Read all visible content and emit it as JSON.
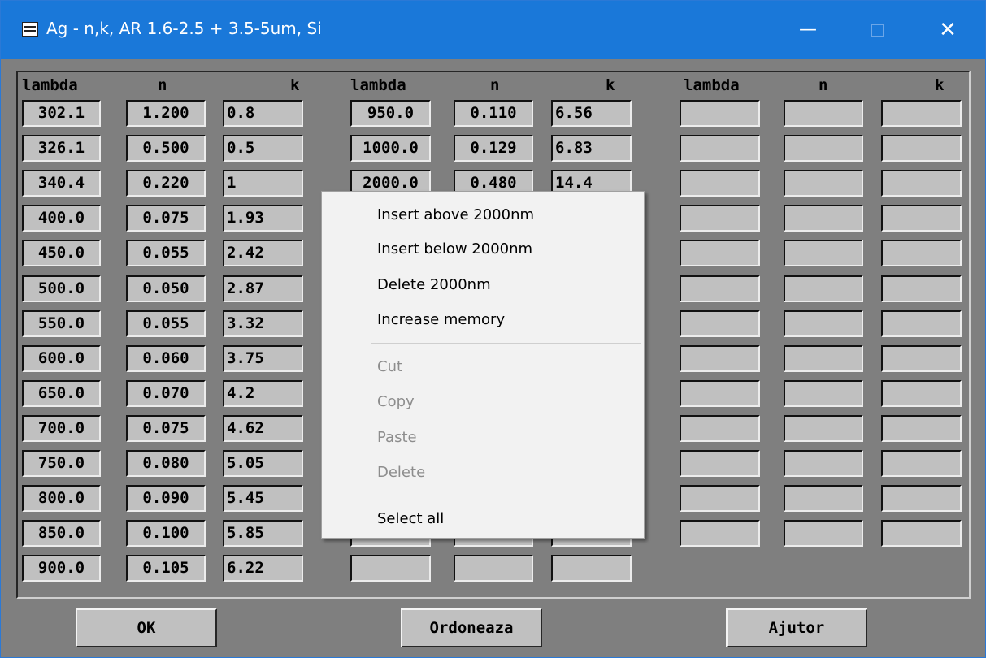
{
  "window": {
    "title": "Ag - n,k, AR 1.6-2.5 + 3.5-5um, Si",
    "minimize_glyph": "—",
    "close_glyph": "✕"
  },
  "columns": [
    {
      "lambda": "lambda",
      "n": "n",
      "k": "k"
    },
    {
      "lambda": "lambda",
      "n": "n",
      "k": "k"
    },
    {
      "lambda": "lambda",
      "n": "n",
      "k": "k"
    }
  ],
  "table": {
    "group1": [
      [
        "302.1",
        "1.200",
        "0.8"
      ],
      [
        "326.1",
        "0.500",
        "0.5"
      ],
      [
        "340.4",
        "0.220",
        "1"
      ],
      [
        "400.0",
        "0.075",
        "1.93"
      ],
      [
        "450.0",
        "0.055",
        "2.42"
      ],
      [
        "500.0",
        "0.050",
        "2.87"
      ],
      [
        "550.0",
        "0.055",
        "3.32"
      ],
      [
        "600.0",
        "0.060",
        "3.75"
      ],
      [
        "650.0",
        "0.070",
        "4.2"
      ],
      [
        "700.0",
        "0.075",
        "4.62"
      ],
      [
        "750.0",
        "0.080",
        "5.05"
      ],
      [
        "800.0",
        "0.090",
        "5.45"
      ],
      [
        "850.0",
        "0.100",
        "5.85"
      ],
      [
        "900.0",
        "0.105",
        "6.22"
      ]
    ],
    "group2": [
      [
        "950.0",
        "0.110",
        "6.56"
      ],
      [
        "1000.0",
        "0.129",
        "6.83"
      ],
      [
        "2000.0",
        "0.480",
        "14.4"
      ]
    ]
  },
  "buttons": {
    "ok": "OK",
    "sort": "Ordoneaza",
    "help": "Ajutor"
  },
  "context_menu": {
    "items": [
      {
        "label": "Insert above 2000nm",
        "enabled": true
      },
      {
        "label": "Insert below 2000nm",
        "enabled": true
      },
      {
        "label": "Delete 2000nm",
        "enabled": true
      },
      {
        "label": "Increase memory",
        "enabled": true
      },
      {
        "label": "Cut",
        "enabled": false
      },
      {
        "label": "Copy",
        "enabled": false
      },
      {
        "label": "Paste",
        "enabled": false
      },
      {
        "label": "Delete",
        "enabled": false
      },
      {
        "label": "Select all",
        "enabled": true
      }
    ]
  },
  "colors": {
    "title_bar": "#1a78d9",
    "background": "#7f7f7f",
    "cell": "#c0c0c0",
    "menu": "#f2f2f2",
    "disabled_text": "#8d8d8d"
  }
}
